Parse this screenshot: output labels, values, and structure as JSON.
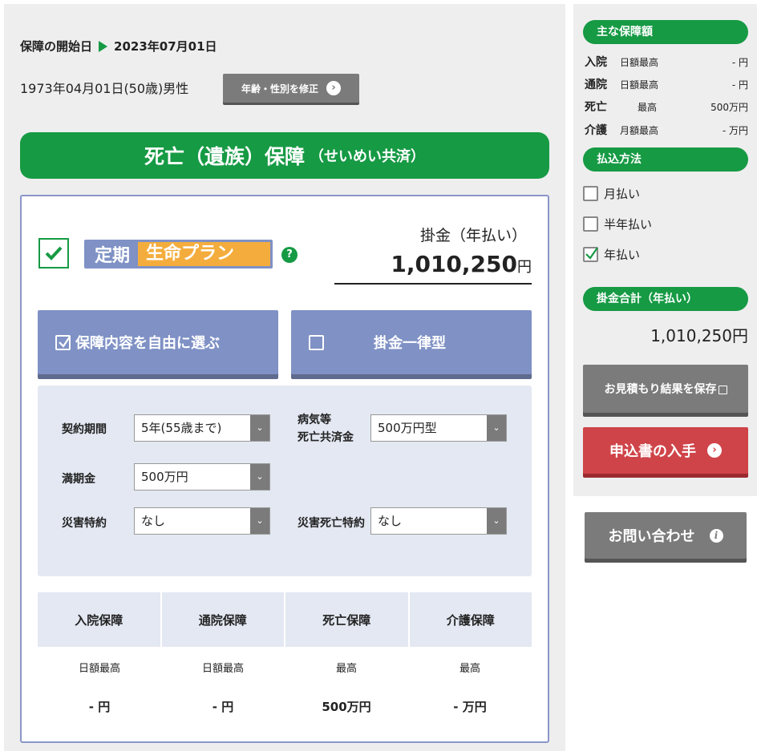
{
  "header": {
    "start_label": "保障の開始日",
    "start_date": "2023年07月01日",
    "birth_info": "1973年04月01日(50歳)男性",
    "edit_button": "年齢・性別を修正"
  },
  "banner": {
    "title": "死亡（遺族）保障",
    "subtitle": "（せいめい共済）"
  },
  "plan": {
    "name_a": "定期",
    "name_b": "生命プラン",
    "help": "?",
    "premium_label": "掛金（年払い）",
    "premium_value": "1,010,250",
    "premium_unit": "円"
  },
  "modes": {
    "free_select": "保障内容を自由に選ぶ",
    "flat_rate": "掛金一律型"
  },
  "options": {
    "term_label": "契約期間",
    "term_value": "5年(55歳まで)",
    "illness_label_1": "病気等",
    "illness_label_2": "死亡共済金",
    "illness_value": "500万円型",
    "maturity_label": "満期金",
    "maturity_value": "500万円",
    "disaster_label": "災害特約",
    "disaster_value": "なし",
    "disaster_death_label": "災害死亡特約",
    "disaster_death_value": "なし"
  },
  "coverage": {
    "headers": [
      "入院保障",
      "通院保障",
      "死亡保障",
      "介護保障"
    ],
    "subs": [
      "日額最高",
      "日額最高",
      "最高",
      "最高"
    ],
    "values": [
      "- 円",
      "- 円",
      "500万円",
      "- 万円"
    ]
  },
  "sidebar": {
    "main_title": "主な保障額",
    "rows": [
      {
        "k": "入院",
        "t": "日額最高",
        "v": "- 円"
      },
      {
        "k": "通院",
        "t": "日額最高",
        "v": "- 円"
      },
      {
        "k": "死亡",
        "t": "最高",
        "v": "500万円"
      },
      {
        "k": "介護",
        "t": "月額最高",
        "v": "- 万円"
      }
    ],
    "pay_title": "払込方法",
    "pay_options": [
      "月払い",
      "半年払い",
      "年払い"
    ],
    "total_title": "掛金合計（年払い）",
    "total_value": "1,010,250円",
    "save_button": "お見積もり結果を保存",
    "apply_button": "申込書の入手",
    "contact_button": "お問い合わせ"
  },
  "colors": {
    "green": "#169a44",
    "blue": "#7f91c5",
    "orange": "#f4ad3d",
    "red": "#cf4449",
    "gray": "#7b7b7b"
  }
}
